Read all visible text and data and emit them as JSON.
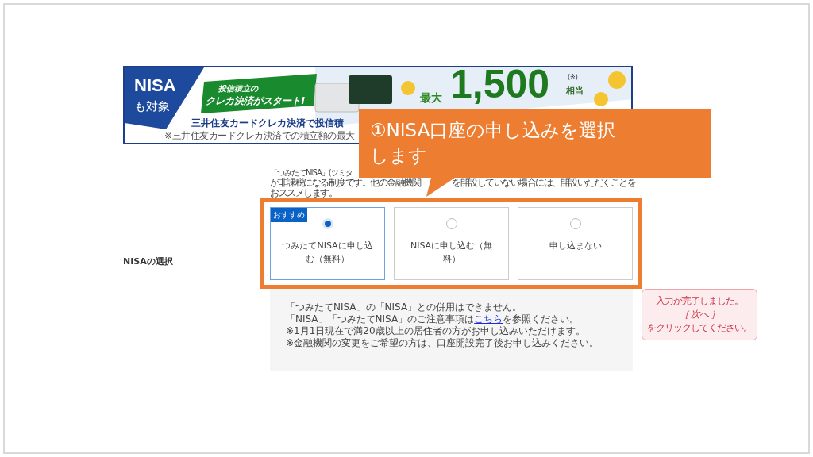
{
  "banner": {
    "badge_title": "NISA",
    "badge_sub": "も対象",
    "tag_lines": [
      "投信積立の",
      "クレカ決済がスタート!"
    ],
    "headline": "三井住友カードクレカ決済で投信積",
    "note": "※三井住友カードクレカ決済での積立額の最大",
    "prize_prefix": "最大",
    "prize_amount": "1,500",
    "prize_mark": "(※)",
    "prize_suffix": "相当"
  },
  "callout": {
    "lines": [
      "①NISA口座の申し込みを選択",
      "します"
    ]
  },
  "intro": {
    "line_1": "「つみたてNISA」(ツミタ",
    "line_2_start": "が非課税になる制度です。他の金融機関",
    "line_2_end": "を開設していない場合には、開設いただくことを",
    "line_3": "おススメします。"
  },
  "field": {
    "label": "NISAの選択",
    "options": [
      {
        "label": "つみたてNISAに申し込む（無料）",
        "badge": "おすすめ",
        "selected": true
      },
      {
        "label": "NISAに申し込む（無料）",
        "selected": false
      },
      {
        "label": "申し込まない",
        "selected": false
      }
    ],
    "highlighted": true
  },
  "notes": {
    "lines": [
      "「つみたてNISA」の「NISA」との併用はできません。",
      {
        "before": "「NISA」「つみたてNISA」のご注意事項は",
        "link": "こちら",
        "after": "を参照ください。"
      },
      "※1月1日現在で満20歳以上の居住者の方がお申し込みいただけます。",
      "※金融機関の変更をご希望の方は、口座開設完了後お申し込みください。"
    ]
  },
  "status": {
    "lines": [
      "入力が完了しました。",
      "［ 次へ ］",
      "をクリックしてください。"
    ]
  }
}
